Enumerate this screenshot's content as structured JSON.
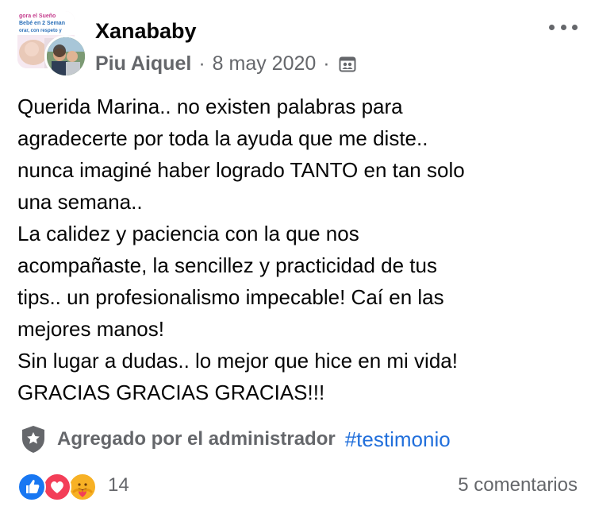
{
  "post": {
    "group_name": "Xanababy",
    "group_thumb_text": [
      "gora el Sueño",
      "Bebé en 2 Seman",
      "orar, con respeto y"
    ],
    "author": "Piu Aiquel",
    "separator": "·",
    "date": "8 may 2020",
    "privacy_icon": "group-privacy-icon",
    "body_lines": [
      "Querida Marina.. no existen palabras para",
      "agradecerte por toda la ayuda que me diste..",
      "nunca imaginé haber logrado TANTO en tan solo",
      "una semana..",
      "La calidez y paciencia con la que nos",
      "acompañaste, la sencillez y practicidad de tus",
      "tips.. un profesionalismo impecable! Caí en las",
      "mejores manos!",
      "Sin lugar a dudas.. lo mejor que hice en mi vida!",
      "GRACIAS GRACIAS GRACIAS!!!"
    ],
    "admin_label": "Agregado por el administrador",
    "hashtag": "#testimonio"
  },
  "reactions": {
    "icons": [
      "like-icon",
      "love-icon",
      "care-icon"
    ],
    "count": "14",
    "comments": "5 comentarios"
  },
  "colors": {
    "secondary_text": "#65676b",
    "hashtag": "#216fdb",
    "like": "#1877f2",
    "love": "#f33e58",
    "care": "#f7b125"
  }
}
